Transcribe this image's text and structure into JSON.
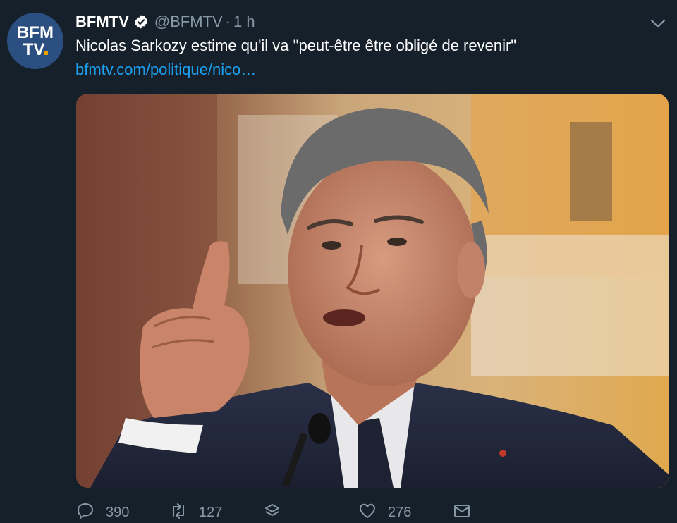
{
  "account": {
    "display_name": "BFMTV",
    "handle": "@BFMTV",
    "separator": "·",
    "time": "1 h",
    "avatar_text_line1": "BFM",
    "avatar_text_line2": "TV"
  },
  "tweet": {
    "text": "Nicolas Sarkozy estime qu'il va \"peut-être être obligé de revenir\"",
    "link": "bfmtv.com/politique/nico…"
  },
  "actions": {
    "replies": "390",
    "retweets": "127",
    "likes": "276"
  },
  "colors": {
    "background": "#15202b",
    "link": "#1da1f2",
    "secondary_text": "#8899a6",
    "avatar_bg": "#2b4f80"
  },
  "icons": {
    "verified": "verified-badge-icon",
    "menu": "chevron-down-icon",
    "reply": "reply-icon",
    "retweet": "retweet-icon",
    "stack": "stack-icon",
    "like": "heart-icon",
    "dm": "envelope-icon"
  }
}
